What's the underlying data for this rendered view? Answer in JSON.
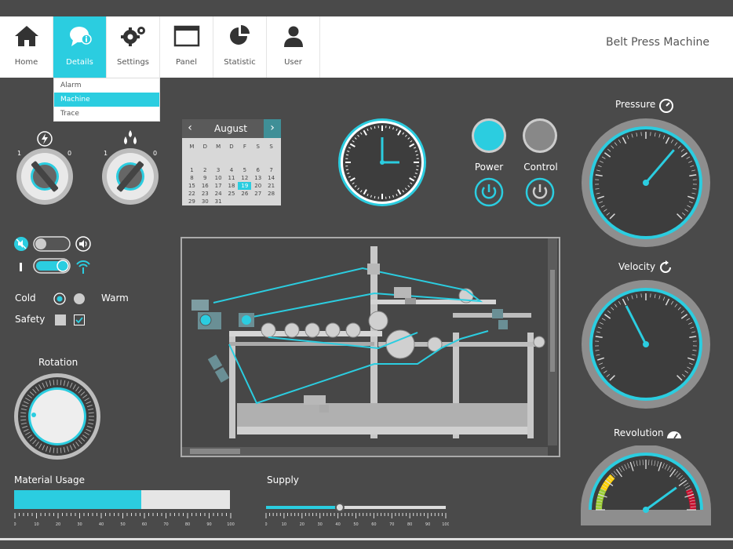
{
  "nav": {
    "items": [
      {
        "label": "Home",
        "icon": "home-icon"
      },
      {
        "label": "Details",
        "icon": "chat-info-icon",
        "active": true
      },
      {
        "label": "Settings",
        "icon": "gears-icon"
      },
      {
        "label": "Panel",
        "icon": "window-icon"
      },
      {
        "label": "Statistic",
        "icon": "pie-chart-icon"
      },
      {
        "label": "User",
        "icon": "user-icon"
      }
    ],
    "title": "Belt Press Machine"
  },
  "dropdown": {
    "items": [
      "Alarm",
      "Machine",
      "Trace"
    ],
    "selected": "Machine"
  },
  "knobs": {
    "power_knob": {
      "min_label": "1",
      "max_label": "0"
    },
    "water_knob": {
      "min_label": "1",
      "max_label": "0"
    }
  },
  "calendar": {
    "month": "August",
    "weekdays": [
      "M",
      "D",
      "M",
      "D",
      "F",
      "S",
      "S"
    ],
    "days": [
      "",
      "",
      "",
      "",
      "",
      "",
      "",
      "1",
      "2",
      "3",
      "4",
      "5",
      "6",
      "7",
      "8",
      "9",
      "10",
      "11",
      "12",
      "13",
      "14",
      "15",
      "16",
      "17",
      "18",
      "19",
      "20",
      "21",
      "22",
      "23",
      "24",
      "25",
      "26",
      "27",
      "28",
      "29",
      "30",
      "31",
      "",
      "",
      "",
      ""
    ],
    "selected_day": "19"
  },
  "clock": {
    "hour": 3,
    "minute": 0
  },
  "buttons": {
    "power_label": "Power",
    "control_label": "Control"
  },
  "toggles": {
    "mute_toggle_on": false,
    "signal_toggle_on": true
  },
  "options": {
    "cold_label": "Cold",
    "warm_label": "Warm",
    "selected": "Cold",
    "safety_label": "Safety",
    "safety_checkbox_1": false,
    "safety_checkbox_2": true
  },
  "rotation": {
    "label": "Rotation"
  },
  "material": {
    "label": "Material Usage",
    "fraction": 0.59,
    "ticks": [
      "0",
      "10",
      "20",
      "30",
      "40",
      "50",
      "60",
      "70",
      "80",
      "90",
      "100"
    ]
  },
  "supply": {
    "label": "Supply",
    "fraction": 0.41,
    "ticks": [
      "0",
      "10",
      "20",
      "30",
      "40",
      "50",
      "60",
      "70",
      "80",
      "90",
      "100"
    ]
  },
  "gauges": {
    "pressure": {
      "label": "Pressure",
      "value": 65
    },
    "velocity": {
      "label": "Velocity",
      "value": 40
    },
    "revolution": {
      "label": "Revolution",
      "value": 80
    }
  },
  "colors": {
    "accent": "#2bcde0",
    "panel": "#4a4a4a"
  }
}
